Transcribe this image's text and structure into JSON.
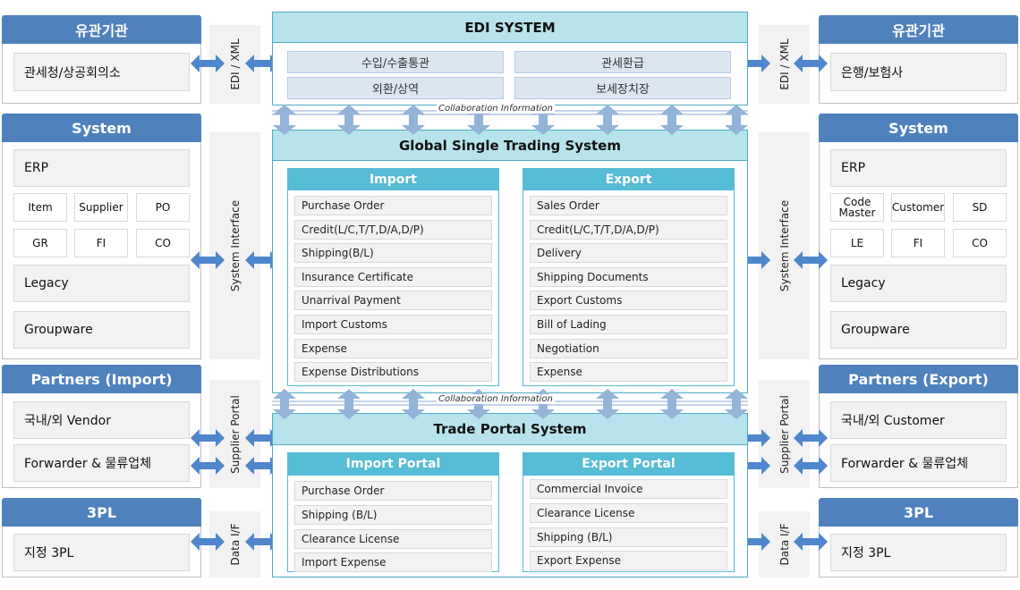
{
  "left": {
    "agency": {
      "title": "유관기관",
      "items": [
        "관세청/상공회의소"
      ]
    },
    "system": {
      "title": "System",
      "erp": "ERP",
      "modules": [
        "Item",
        "Supplier",
        "PO",
        "GR",
        "FI",
        "CO"
      ],
      "legacy": "Legacy",
      "groupware": "Groupware"
    },
    "partners": {
      "title": "Partners (Import)",
      "items": [
        "국내/외 Vendor",
        "Forwarder & 물류업체"
      ]
    },
    "tpl": {
      "title": "3PL",
      "items": [
        "지정 3PL"
      ]
    }
  },
  "right": {
    "agency": {
      "title": "유관기관",
      "items": [
        "은행/보험사"
      ]
    },
    "system": {
      "title": "System",
      "erp": "ERP",
      "modules": [
        "Code Master",
        "Customer",
        "SD",
        "LE",
        "FI",
        "CO"
      ],
      "legacy": "Legacy",
      "groupware": "Groupware"
    },
    "partners": {
      "title": "Partners (Export)",
      "items": [
        "국내/외 Customer",
        "Forwarder & 물류업체"
      ]
    },
    "tpl": {
      "title": "3PL",
      "items": [
        "지정 3PL"
      ]
    }
  },
  "interfaces": [
    "EDI / XML",
    "System Interface",
    "Supplier Portal",
    "Data I/F"
  ],
  "edi": {
    "title": "EDI SYSTEM",
    "items": [
      "수입/수출통관",
      "관세환급",
      "외환/상역",
      "보세장치장"
    ]
  },
  "collaboration": "Collaboration Information",
  "gsts": {
    "title": "Global Single Trading System",
    "import": {
      "title": "Import",
      "items": [
        "Purchase Order",
        "Credit(L/C,T/T,D/A,D/P)",
        "Shipping(B/L)",
        "Insurance Certificate",
        "Unarrival Payment",
        "Import Customs",
        "Expense",
        "Expense Distributions"
      ]
    },
    "export": {
      "title": "Export",
      "items": [
        "Sales Order",
        "Credit(L/C,T/T,D/A,D/P)",
        "Delivery",
        "Shipping Documents",
        "Export Customs",
        "Bill of Lading",
        "Negotiation",
        "Expense"
      ]
    }
  },
  "portal": {
    "title": "Trade Portal System",
    "import": {
      "title": "Import Portal",
      "items": [
        "Purchase Order",
        "Shipping (B/L)",
        "Clearance License",
        "Import Expense"
      ]
    },
    "export": {
      "title": "Export Portal",
      "items": [
        "Commercial Invoice",
        "Clearance License",
        "Shipping (B/L)",
        "Export Expense"
      ]
    }
  },
  "colors": {
    "panel_header": "#4f81bd",
    "cyan_header": "#b7e3ec",
    "sub_header": "#57bcd5",
    "arrow": "#4f86cc",
    "collab_arrow": "#94b3d9"
  }
}
